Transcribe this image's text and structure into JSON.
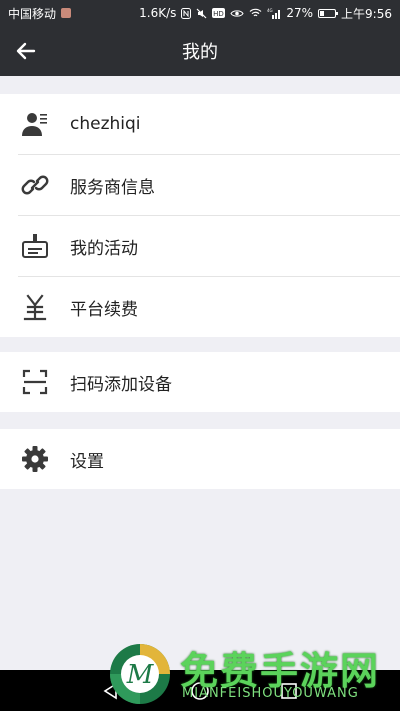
{
  "status_bar": {
    "carrier": "中国移动",
    "speed": "1.6K/s",
    "battery": "27%",
    "time": "上午9:56",
    "network": "4G"
  },
  "header": {
    "title": "我的"
  },
  "profile_section": {
    "items": [
      {
        "label": "chezhiqi",
        "icon": "user-profile-icon"
      },
      {
        "label": "服务商信息",
        "icon": "link-icon"
      },
      {
        "label": "我的活动",
        "icon": "activity-icon"
      },
      {
        "label": "平台续费",
        "icon": "yen-icon"
      }
    ]
  },
  "scan_section": {
    "items": [
      {
        "label": "扫码添加设备",
        "icon": "scan-icon"
      }
    ]
  },
  "settings_section": {
    "items": [
      {
        "label": "设置",
        "icon": "gear-icon"
      }
    ]
  },
  "watermark": {
    "title": "免费手游网",
    "subtitle": "MIANFEISHOUYOUWANG"
  },
  "colors": {
    "header_bg": "#2d2f33",
    "page_bg": "#efeff4",
    "icon": "#3a3a3a"
  }
}
